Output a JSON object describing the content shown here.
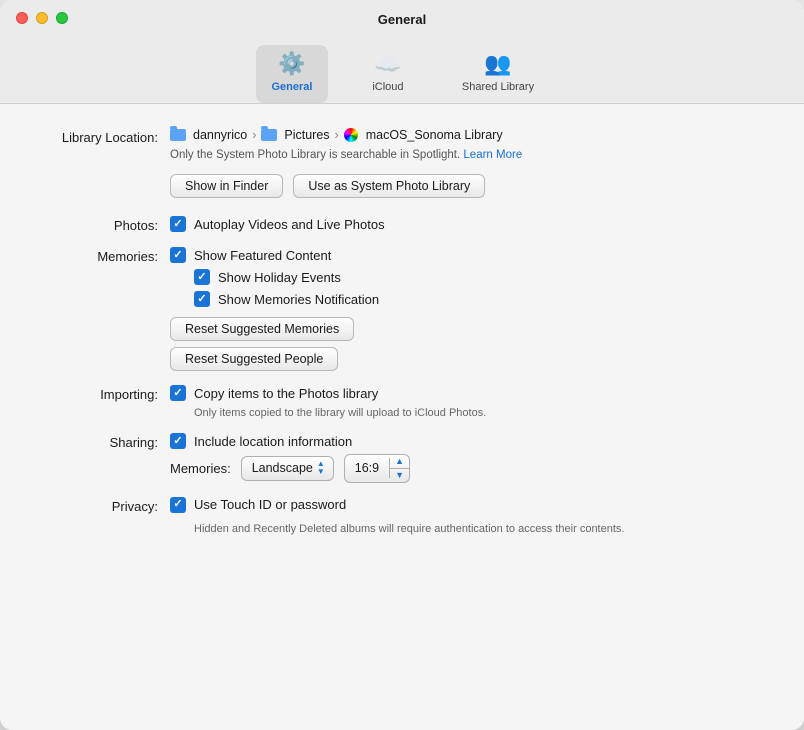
{
  "window": {
    "title": "General"
  },
  "toolbar": {
    "items": [
      {
        "id": "general",
        "label": "General",
        "active": true
      },
      {
        "id": "icloud",
        "label": "iCloud",
        "active": false
      },
      {
        "id": "shared-library",
        "label": "Shared Library",
        "active": false
      }
    ]
  },
  "library_location": {
    "label": "Library Location:",
    "path_parts": [
      "dannyrico",
      "Pictures",
      "macOS_Sonoma Library"
    ],
    "spotlight_text": "Only the System Photo Library is searchable in Spotlight.",
    "learn_more": "Learn More",
    "show_in_finder": "Show in Finder",
    "use_as_system": "Use as System Photo Library"
  },
  "photos": {
    "label": "Photos:",
    "autoplay_label": "Autoplay Videos and Live Photos",
    "autoplay_checked": true
  },
  "memories": {
    "label": "Memories:",
    "featured_content_label": "Show Featured Content",
    "featured_content_checked": true,
    "holiday_events_label": "Show Holiday Events",
    "holiday_events_checked": true,
    "memories_notification_label": "Show Memories Notification",
    "memories_notification_checked": true,
    "reset_suggested_memories": "Reset Suggested Memories",
    "reset_suggested_people": "Reset Suggested People"
  },
  "importing": {
    "label": "Importing:",
    "copy_label": "Copy items to the Photos library",
    "copy_checked": true,
    "copy_subtext": "Only items copied to the library will upload to iCloud Photos."
  },
  "sharing": {
    "label": "Sharing:",
    "include_location_label": "Include location information",
    "include_location_checked": true,
    "memories_label": "Memories:",
    "landscape_value": "Landscape",
    "aspect_ratio_value": "16:9"
  },
  "privacy": {
    "label": "Privacy:",
    "touch_id_label": "Use Touch ID or password",
    "touch_id_checked": true,
    "touch_id_subtext": "Hidden and Recently Deleted albums will require authentication to access their contents."
  }
}
